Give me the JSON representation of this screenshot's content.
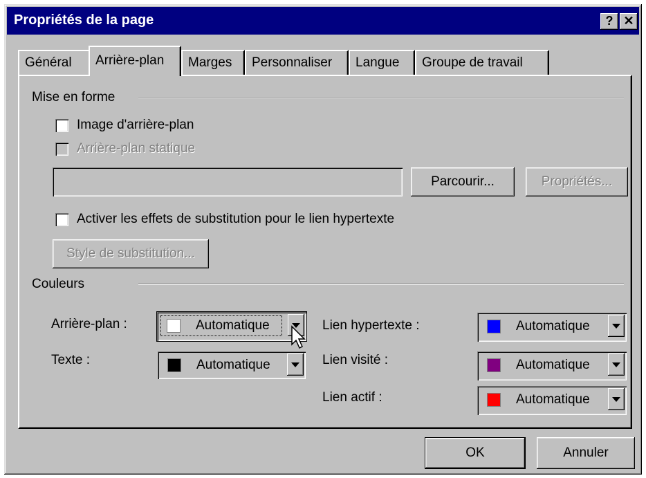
{
  "window": {
    "title": "Propriétés de la page",
    "help_button": "?",
    "close_button": "✕"
  },
  "tabs": [
    {
      "label": "Général",
      "active": false
    },
    {
      "label": "Arrière-plan",
      "active": true
    },
    {
      "label": "Marges",
      "active": false
    },
    {
      "label": "Personnaliser",
      "active": false
    },
    {
      "label": "Langue",
      "active": false
    },
    {
      "label": "Groupe de travail",
      "active": false
    }
  ],
  "formatting": {
    "group_label": "Mise en forme",
    "background_image": {
      "label": "Image d'arrière-plan",
      "checked": false
    },
    "static_background": {
      "label": "Arrière-plan statique",
      "checked": false,
      "disabled": true
    },
    "image_path": {
      "value": ""
    },
    "browse_button": "Parcourir...",
    "properties_button": "Propriétés...",
    "rollover": {
      "label": "Activer les effets de substitution pour le lien hypertexte",
      "checked": false
    },
    "rollover_style_button": "Style de substitution..."
  },
  "colors": {
    "group_label": "Couleurs",
    "background": {
      "label": "Arrière-plan :",
      "value": "Automatique",
      "swatch": "#ffffff"
    },
    "text": {
      "label": "Texte :",
      "value": "Automatique",
      "swatch": "#000000"
    },
    "hyperlink": {
      "label": "Lien hypertexte :",
      "value": "Automatique",
      "swatch": "#0000ff"
    },
    "visited_link": {
      "label": "Lien visité :",
      "value": "Automatique",
      "swatch": "#800080"
    },
    "active_link": {
      "label": "Lien actif :",
      "value": "Automatique",
      "swatch": "#ff0000"
    }
  },
  "footer": {
    "ok_button": "OK",
    "cancel_button": "Annuler"
  },
  "theme": {
    "titlebar": "#000080",
    "face": "#c0c0c0"
  }
}
